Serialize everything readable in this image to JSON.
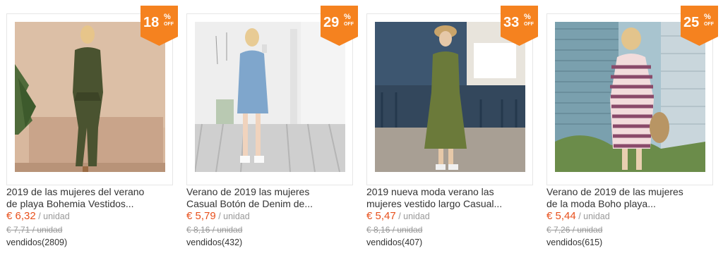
{
  "products": [
    {
      "discount_number": "18",
      "discount_symbol": "%",
      "discount_label": "OFF",
      "title_line1": "2019 de las mujeres del verano",
      "title_line2": "de playa Bohemia Vestidos...",
      "price": "€ 6,32",
      "unit": " / unidad",
      "old_price": "€ 7,71 / unidad",
      "sold": "vendidos(2809)",
      "image_icon": "olive-wrap-dress-photo"
    },
    {
      "discount_number": "29",
      "discount_symbol": "%",
      "discount_label": "OFF",
      "title_line1": "Verano de 2019 las mujeres",
      "title_line2": "Casual Botón de Denim de...",
      "price": "€ 5,79",
      "unit": " / unidad",
      "old_price": "€ 8,16 / unidad",
      "sold": "vendidos(432)",
      "image_icon": "denim-shirt-dress-photo"
    },
    {
      "discount_number": "33",
      "discount_symbol": "%",
      "discount_label": "OFF",
      "title_line1": "2019 nueva moda verano las",
      "title_line2": "mujeres vestido largo Casual...",
      "price": "€ 5,47",
      "unit": " / unidad",
      "old_price": "€ 8,16 / unidad",
      "sold": "vendidos(407)",
      "image_icon": "green-long-dress-photo"
    },
    {
      "discount_number": "25",
      "discount_symbol": "%",
      "discount_label": "OFF",
      "title_line1": "Verano de 2019 de las mujeres",
      "title_line2": "de la moda Boho playa...",
      "price": "€ 5,44",
      "unit": " / unidad",
      "old_price": "€ 7,26 / unidad",
      "sold": "vendidos(615)",
      "image_icon": "striped-dress-photo"
    }
  ],
  "colors": {
    "badge": "#f5821f",
    "price": "#e8501c",
    "muted": "#999999",
    "text": "#333333"
  }
}
